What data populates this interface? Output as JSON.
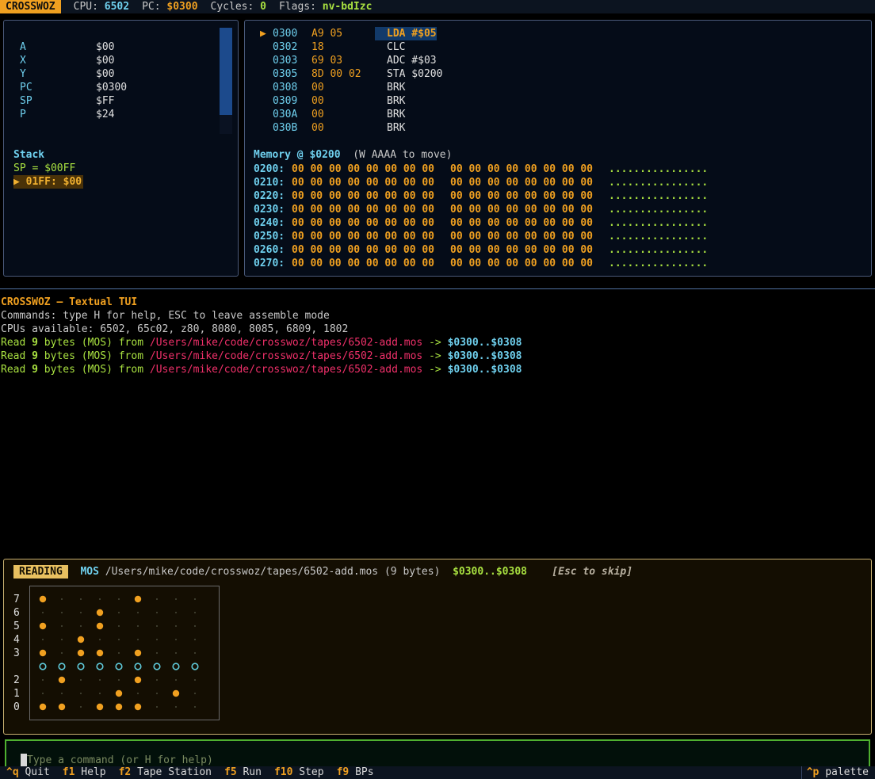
{
  "topbar": {
    "brand": "CROSSWOZ",
    "cpu_label": "CPU:",
    "cpu_value": "6502",
    "pc_label": "PC:",
    "pc_value": "$0300",
    "cycles_label": "Cycles:",
    "cycles_value": "0",
    "flags_label": "Flags:",
    "flags_value": "nv-bdIzc"
  },
  "registers": [
    {
      "name": "A",
      "value": "$00"
    },
    {
      "name": "X",
      "value": "$00"
    },
    {
      "name": "Y",
      "value": "$00"
    },
    {
      "name": "PC",
      "value": "$0300"
    },
    {
      "name": "SP",
      "value": "$FF"
    },
    {
      "name": "P",
      "value": "$24"
    }
  ],
  "stack": {
    "title": "Stack",
    "sp_line": "SP = $00FF",
    "entry": "▶ 01FF: $00"
  },
  "disassembly": {
    "pointer": "▶",
    "lines": [
      {
        "addr": "0300",
        "bytes": "A9 05",
        "asm": "LDA #$05"
      },
      {
        "addr": "0302",
        "bytes": "18",
        "asm": "CLC"
      },
      {
        "addr": "0303",
        "bytes": "69 03",
        "asm": "ADC #$03"
      },
      {
        "addr": "0305",
        "bytes": "8D 00 02",
        "asm": "STA $0200"
      },
      {
        "addr": "0308",
        "bytes": "00",
        "asm": "BRK"
      },
      {
        "addr": "0309",
        "bytes": "00",
        "asm": "BRK"
      },
      {
        "addr": "030A",
        "bytes": "00",
        "asm": "BRK"
      },
      {
        "addr": "030B",
        "bytes": "00",
        "asm": "BRK"
      }
    ]
  },
  "memory": {
    "title": "Memory @ $0200",
    "hint": "(W AAAA to move)",
    "rows": [
      {
        "addr": "0200:",
        "hex1": "00 00 00 00 00 00 00 00",
        "hex2": "00 00 00 00 00 00 00 00",
        "ascii": "................"
      },
      {
        "addr": "0210:",
        "hex1": "00 00 00 00 00 00 00 00",
        "hex2": "00 00 00 00 00 00 00 00",
        "ascii": "................"
      },
      {
        "addr": "0220:",
        "hex1": "00 00 00 00 00 00 00 00",
        "hex2": "00 00 00 00 00 00 00 00",
        "ascii": "................"
      },
      {
        "addr": "0230:",
        "hex1": "00 00 00 00 00 00 00 00",
        "hex2": "00 00 00 00 00 00 00 00",
        "ascii": "................"
      },
      {
        "addr": "0240:",
        "hex1": "00 00 00 00 00 00 00 00",
        "hex2": "00 00 00 00 00 00 00 00",
        "ascii": "................"
      },
      {
        "addr": "0250:",
        "hex1": "00 00 00 00 00 00 00 00",
        "hex2": "00 00 00 00 00 00 00 00",
        "ascii": "................"
      },
      {
        "addr": "0260:",
        "hex1": "00 00 00 00 00 00 00 00",
        "hex2": "00 00 00 00 00 00 00 00",
        "ascii": "................"
      },
      {
        "addr": "0270:",
        "hex1": "00 00 00 00 00 00 00 00",
        "hex2": "00 00 00 00 00 00 00 00",
        "ascii": "................"
      }
    ]
  },
  "console": {
    "title": "CROSSWOZ — Textual TUI",
    "lines": [
      "Commands: type H for help, ESC to leave assemble mode",
      "CPUs available: 6502, 65c02, z80, 8080, 8085, 6809, 1802"
    ],
    "reads": [
      {
        "pre": "Read ",
        "count": "9",
        "mid": " bytes (",
        "fmt": "MOS",
        "post": ") from ",
        "path": "/Users/mike/code/crosswoz/tapes/6502-add.mos",
        "arrow": " -> ",
        "range": "$0300..$0308"
      },
      {
        "pre": "Read ",
        "count": "9",
        "mid": " bytes (",
        "fmt": "MOS",
        "post": ") from ",
        "path": "/Users/mike/code/crosswoz/tapes/6502-add.mos",
        "arrow": " -> ",
        "range": "$0300..$0308"
      },
      {
        "pre": "Read ",
        "count": "9",
        "mid": " bytes (",
        "fmt": "MOS",
        "post": ") from ",
        "path": "/Users/mike/code/crosswoz/tapes/6502-add.mos",
        "arrow": " -> ",
        "range": "$0300..$0308"
      }
    ]
  },
  "tape": {
    "badge": "READING",
    "format": "MOS",
    "path_info": "/Users/mike/code/crosswoz/tapes/6502-add.mos (9 bytes)",
    "range": "$0300..$0308",
    "skip_hint": "[Esc to skip]",
    "row_labels": [
      "7",
      "6",
      "5",
      "4",
      "3",
      "",
      "2",
      "1",
      "0"
    ],
    "holes": [
      [
        1,
        0,
        0,
        0,
        0,
        1,
        0,
        0,
        0
      ],
      [
        0,
        0,
        0,
        1,
        0,
        0,
        0,
        0,
        0
      ],
      [
        1,
        0,
        0,
        1,
        0,
        0,
        0,
        0,
        0
      ],
      [
        0,
        0,
        1,
        0,
        0,
        0,
        0,
        0,
        0
      ],
      [
        1,
        0,
        1,
        1,
        0,
        1,
        0,
        0,
        0
      ],
      [
        2,
        2,
        2,
        2,
        2,
        2,
        2,
        2,
        2
      ],
      [
        0,
        1,
        0,
        0,
        0,
        1,
        0,
        0,
        0
      ],
      [
        0,
        0,
        0,
        0,
        1,
        0,
        0,
        1,
        0
      ],
      [
        1,
        1,
        0,
        1,
        1,
        1,
        0,
        0,
        0
      ]
    ],
    "colors": {
      "hole": "#f0a020",
      "sprocket": "#5fc8d8",
      "dot": "#4a4a3a"
    }
  },
  "command_input": {
    "placeholder": "Type a command (or H for help)"
  },
  "footer": {
    "bindings": [
      {
        "key": "^q",
        "desc": "Quit"
      },
      {
        "key": "f1",
        "desc": "Help"
      },
      {
        "key": "f2",
        "desc": "Tape Station"
      },
      {
        "key": "f5",
        "desc": "Run"
      },
      {
        "key": "f10",
        "desc": "Step"
      },
      {
        "key": "f9",
        "desc": "BPs"
      }
    ],
    "palette_key": "^p",
    "palette_desc": "palette"
  }
}
